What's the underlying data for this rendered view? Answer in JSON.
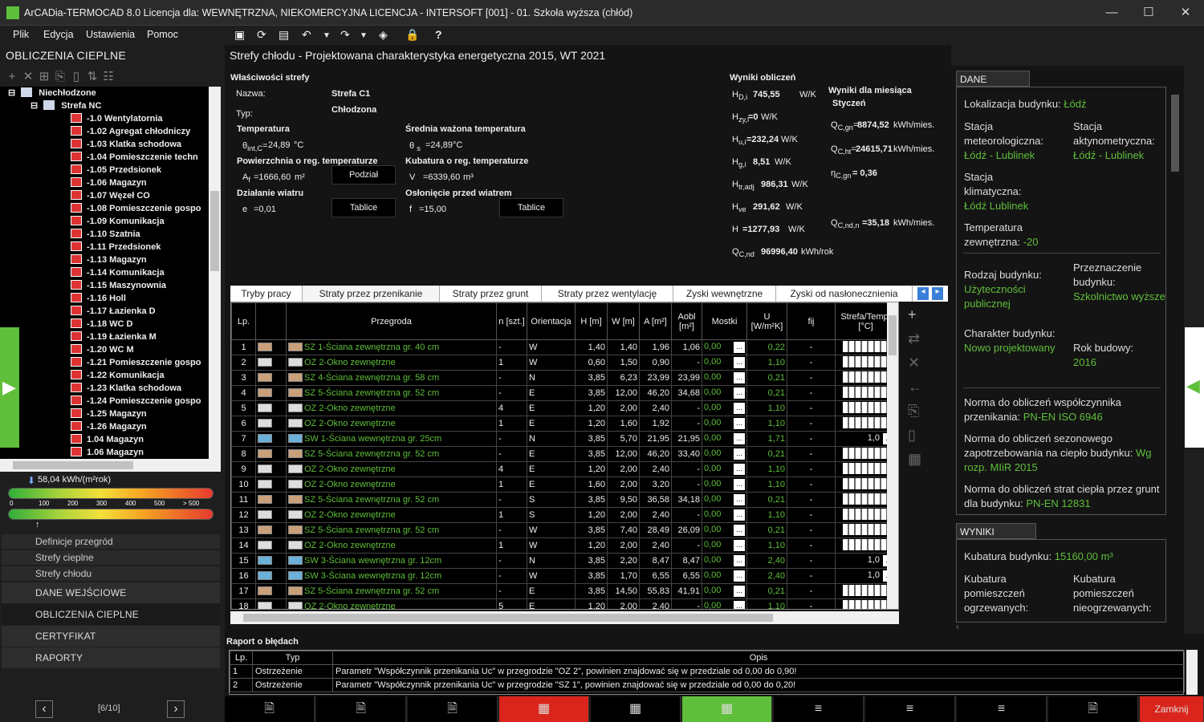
{
  "window": {
    "title": "ArCADia-TERMOCAD 8.0 Licencja dla: WEWNĘTRZNA, NIEKOMERCYJNA LICENCJA - INTERSOFT [001] - 01. Szkoła wyższa (chłód)",
    "minimize": "—",
    "maximize": "☐",
    "close": "✕"
  },
  "menu": {
    "items": [
      "Plik",
      "Edycja",
      "Ustawienia",
      "Pomoc"
    ]
  },
  "left": {
    "header": "OBLICZENIA CIEPLNE",
    "tree": {
      "root": "Niechłodzone",
      "zone": "Strefa NC",
      "rooms": [
        "-1.0 Wentylatornia",
        "-1.02 Agregat chłodniczy",
        "-1.03 Klatka schodowa",
        "-1.04 Pomieszczenie techn",
        "-1.05 Przedsionek",
        "-1.06 Magazyn",
        "-1.07 Węzeł CO",
        "-1.08 Pomieszczenie gospo",
        "-1.09 Komunikacja",
        "-1.10 Szatnia",
        "-1.11 Przedsionek",
        "-1.13 Magazyn",
        "-1.14 Komunikacja",
        "-1.15 Maszynownia",
        "-1.16 Holl",
        "-1.17 Łazienka D",
        "-1.18 WC D",
        "-1.19 Łazienka M",
        "-1.20 WC M",
        "-1.21 Pomieszczenie gospo",
        "-1.22 Komunikacja",
        "-1.23 Klatka schodowa",
        "-1.24 Pomieszczenie gospo",
        "-1.25 Magazyn",
        "-1.26 Magazyn",
        "1.04 Magazyn",
        "1.06 Magazyn"
      ]
    },
    "energy": {
      "value": "58,04 kWh/(m²rok)",
      "ticks": [
        "0",
        "100",
        "200",
        "300",
        "400",
        "500",
        "> 500"
      ],
      "marker_fraction": 0.116
    },
    "nav_sub": [
      "Definicje przegród",
      "Strefy cieplne",
      "Strefy chłodu"
    ],
    "nav_main": [
      "DANE WEJŚCIOWE",
      "OBLICZENIA CIEPLNE",
      "CERTYFIKAT",
      "RAPORTY"
    ],
    "pager": {
      "label": "[6/10]",
      "prev": "‹",
      "next": "›"
    }
  },
  "main": {
    "title": "Strefy chłodu - Projektowana charakterystyka energetyczna 2015, WT 2021",
    "props": {
      "section": "Właściwości strefy",
      "name_label": "Nazwa:",
      "name_value": "Strefa C1",
      "type_label": "Typ:",
      "type_value": "Chłodzona",
      "temp_label": "Temperatura",
      "temp_value": "24,89",
      "avg_temp_label": "Średnia ważona temperatura",
      "avg_temp_value": "=24,89",
      "area_label": "Powierzchnia o reg. temperaturze",
      "area_value": "=1666,60",
      "volume_label": "Kubatura o reg. temperaturze",
      "volume_value": "=6339,60",
      "podzial": "Podział",
      "wind_label": "Działanie wiatru",
      "wind_value": "=0,01",
      "shield_label": "Osłonięcie przed wiatrem",
      "shield_value": "=15,00",
      "tablice": "Tablice",
      "unit_c": "°C",
      "unit_m2": "m²",
      "unit_m3": "m³"
    },
    "results": {
      "header": "Wyniki obliczeń",
      "HD": "745,55",
      "Hzy": "=0",
      "Hu": "=232,24",
      "Hg": "8,51",
      "Htr": "986,31",
      "Hve": "291,62",
      "H": "=1277,93",
      "Qcnd": "96996,40",
      "unit_wk": "W/K",
      "unit_kwh_rok": "kWh/rok"
    },
    "month": {
      "header": "Wyniki dla miesiąca",
      "month": "Styczeń",
      "Qcgn": "8874,52",
      "Qcht": "24615,71",
      "ncgn": "= 0,36",
      "Qcndn": "=35,18",
      "unit": "kWh/mies."
    },
    "tabs": [
      "Tryby pracy",
      "Straty przez przenikanie",
      "Straty przez grunt",
      "Straty przez wentylację",
      "Zyski wewnętrzne",
      "Zyski od nasłonecznienia"
    ],
    "columns": [
      "Lp.",
      "",
      "Przegroda",
      "n [szt.]",
      "Orientacja",
      "H [m]",
      "W [m]",
      "A [m²]",
      "Aobl [m²]",
      "Mostki",
      "U [W/m²K]",
      "fij",
      "Strefa/Temp. [°C]"
    ],
    "rows": [
      {
        "lp": "1",
        "kind": "sz",
        "p": "SZ 1-Ściana zewnętrzna gr. 40 cm",
        "n": "-",
        "o": "W",
        "h": "1,40",
        "w": "1,40",
        "a": "1,96",
        "ao": "1,06",
        "m": "0,00",
        "u": "0,22",
        "f": "-",
        "s": ""
      },
      {
        "lp": "2",
        "kind": "oz",
        "p": "OZ 2-Okno zewnętrzne",
        "n": "1",
        "o": "W",
        "h": "0,60",
        "w": "1,50",
        "a": "0,90",
        "ao": "-",
        "m": "0,00",
        "u": "1,10",
        "f": "-",
        "s": ""
      },
      {
        "lp": "3",
        "kind": "sz",
        "p": "SZ 4-Ściana zewnętrzna gr. 58 cm",
        "n": "-",
        "o": "N",
        "h": "3,85",
        "w": "6,23",
        "a": "23,99",
        "ao": "23,99",
        "m": "0,00",
        "u": "0,21",
        "f": "-",
        "s": ""
      },
      {
        "lp": "4",
        "kind": "sz",
        "p": "SZ 5-Ściana zewnętrzna gr. 52 cm",
        "n": "-",
        "o": "E",
        "h": "3,85",
        "w": "12,00",
        "a": "46,20",
        "ao": "34,68",
        "m": "0,00",
        "u": "0,21",
        "f": "-",
        "s": ""
      },
      {
        "lp": "5",
        "kind": "oz",
        "p": "OZ 2-Okno zewnętrzne",
        "n": "4",
        "o": "E",
        "h": "1,20",
        "w": "2,00",
        "a": "2,40",
        "ao": "-",
        "m": "0,00",
        "u": "1,10",
        "f": "-",
        "s": ""
      },
      {
        "lp": "6",
        "kind": "oz",
        "p": "OZ 2-Okno zewnętrzne",
        "n": "1",
        "o": "E",
        "h": "1,20",
        "w": "1,60",
        "a": "1,92",
        "ao": "-",
        "m": "0,00",
        "u": "1,10",
        "f": "-",
        "s": ""
      },
      {
        "lp": "7",
        "kind": "sw",
        "p": "SW 1-Ściana wewnętrzna gr. 25cm",
        "n": "-",
        "o": "N",
        "h": "3,85",
        "w": "5,70",
        "a": "21,95",
        "ao": "21,95",
        "m": "0,00",
        "u": "1,71",
        "f": "-",
        "s": "1,0"
      },
      {
        "lp": "8",
        "kind": "sz",
        "p": "SZ 5-Ściana zewnętrzna gr. 52 cm",
        "n": "-",
        "o": "E",
        "h": "3,85",
        "w": "12,00",
        "a": "46,20",
        "ao": "33,40",
        "m": "0,00",
        "u": "0,21",
        "f": "-",
        "s": ""
      },
      {
        "lp": "9",
        "kind": "oz",
        "p": "OZ 2-Okno zewnętrzne",
        "n": "4",
        "o": "E",
        "h": "1,20",
        "w": "2,00",
        "a": "2,40",
        "ao": "-",
        "m": "0,00",
        "u": "1,10",
        "f": "-",
        "s": ""
      },
      {
        "lp": "10",
        "kind": "oz",
        "p": "OZ 2-Okno zewnętrzne",
        "n": "1",
        "o": "E",
        "h": "1,60",
        "w": "2,00",
        "a": "3,20",
        "ao": "-",
        "m": "0,00",
        "u": "1,10",
        "f": "-",
        "s": ""
      },
      {
        "lp": "11",
        "kind": "sz",
        "p": "SZ 5-Ściana zewnętrzna gr. 52 cm",
        "n": "-",
        "o": "S",
        "h": "3,85",
        "w": "9,50",
        "a": "36,58",
        "ao": "34,18",
        "m": "0,00",
        "u": "0,21",
        "f": "-",
        "s": ""
      },
      {
        "lp": "12",
        "kind": "oz",
        "p": "OZ 2-Okno zewnętrzne",
        "n": "1",
        "o": "S",
        "h": "1,20",
        "w": "2,00",
        "a": "2,40",
        "ao": "-",
        "m": "0,00",
        "u": "1,10",
        "f": "-",
        "s": ""
      },
      {
        "lp": "13",
        "kind": "sz",
        "p": "SZ 5-Ściana zewnętrzna gr. 52 cm",
        "n": "-",
        "o": "W",
        "h": "3,85",
        "w": "7,40",
        "a": "28,49",
        "ao": "26,09",
        "m": "0,00",
        "u": "0,21",
        "f": "-",
        "s": ""
      },
      {
        "lp": "14",
        "kind": "oz",
        "p": "OZ 2-Okno zewnętrzne",
        "n": "1",
        "o": "W",
        "h": "1,20",
        "w": "2,00",
        "a": "2,40",
        "ao": "-",
        "m": "0,00",
        "u": "1,10",
        "f": "-",
        "s": ""
      },
      {
        "lp": "15",
        "kind": "sw",
        "p": "SW 3-Ściana wewnętrzna gr. 12cm",
        "n": "-",
        "o": "N",
        "h": "3,85",
        "w": "2,20",
        "a": "8,47",
        "ao": "8,47",
        "m": "0,00",
        "u": "2,40",
        "f": "-",
        "s": "1,0"
      },
      {
        "lp": "16",
        "kind": "sw",
        "p": "SW 3-Ściana wewnętrzna gr. 12cm",
        "n": "-",
        "o": "W",
        "h": "3,85",
        "w": "1,70",
        "a": "6,55",
        "ao": "6,55",
        "m": "0,00",
        "u": "2,40",
        "f": "-",
        "s": "1,0"
      },
      {
        "lp": "17",
        "kind": "sz",
        "p": "SZ 5-Ściana zewnętrzna gr. 52 cm",
        "n": "-",
        "o": "E",
        "h": "3,85",
        "w": "14,50",
        "a": "55,83",
        "ao": "41,91",
        "m": "0,00",
        "u": "0,21",
        "f": "-",
        "s": ""
      },
      {
        "lp": "18",
        "kind": "oz",
        "p": "OZ 2-Okno zewnętrzne",
        "n": "5",
        "o": "E",
        "h": "1,20",
        "w": "2,00",
        "a": "2,40",
        "ao": "-",
        "m": "0,00",
        "u": "1,10",
        "f": "-",
        "s": ""
      }
    ]
  },
  "errors": {
    "header": "Raport o błędach",
    "columns": [
      "Lp.",
      "Typ",
      "Opis"
    ],
    "rows": [
      {
        "lp": "1",
        "typ": "Ostrzeżenie",
        "opis": "Parametr \"Współczynnik przenikania Uc\" w przegrodzie \"OZ 2\", powinien znajdować się w przedziale od 0,00 do 0,90!"
      },
      {
        "lp": "2",
        "typ": "Ostrzeżenie",
        "opis": "Parametr \"Współczynnik przenikania Uc\" w przegrodzie \"SZ 1\", powinien znajdować się w przedziale od 0,00 do 0,20!"
      }
    ]
  },
  "bottom": {
    "close": "Zamknij"
  },
  "right": {
    "general_header": "DANE OGÓLNE",
    "loc_label": "Lokalizacja budynku:",
    "loc_value": "Łódź",
    "met_label": "Stacja meteorologiczna:",
    "met_value": "Łódź - Lublinek",
    "act_label": "Stacja aktynometryczna:",
    "act_value": "Łódź - Lublinek",
    "clim_label": "Stacja klimatyczna:",
    "clim_value": "Łódź Lublinek",
    "temp_label": "Temperatura zewnętrzna:",
    "temp_value": "-20",
    "kind_label": "Rodzaj budynku:",
    "kind_value": "Użyteczności publicznej",
    "purpose_label": "Przeznaczenie budynku:",
    "purpose_value": "Szkolnictwo wyższe",
    "char_label": "Charakter budynku:",
    "char_value": "Nowo projektowany",
    "year_label": "Rok budowy:",
    "year_value": "2016",
    "norm1_label": "Norma do obliczeń współczynnika przenikania:",
    "norm1_value": "PN-EN ISO 6946",
    "norm2_label": "Norma do obliczeń sezonowego zapotrzebowania na ciepło budynku:",
    "norm2_value": "Wg rozp. MIiR 2015",
    "norm3_label": "Norma do obliczeń strat ciepła przez grunt dla budynku:",
    "norm3_value": "PN-EN 12831",
    "results_header": "WYNIKI OGÓLNE",
    "kub_label": "Kubatura budynku:",
    "kub_value": "15160,00 m³",
    "kub_heated": "Kubatura pomieszczeń ogrzewanych:",
    "kub_unheated": "Kubatura pomieszczeń nieogrzewanych:"
  },
  "colors": {
    "accent": "#5fbf3a",
    "close": "#d9251b",
    "active": "#5fbf3a"
  }
}
